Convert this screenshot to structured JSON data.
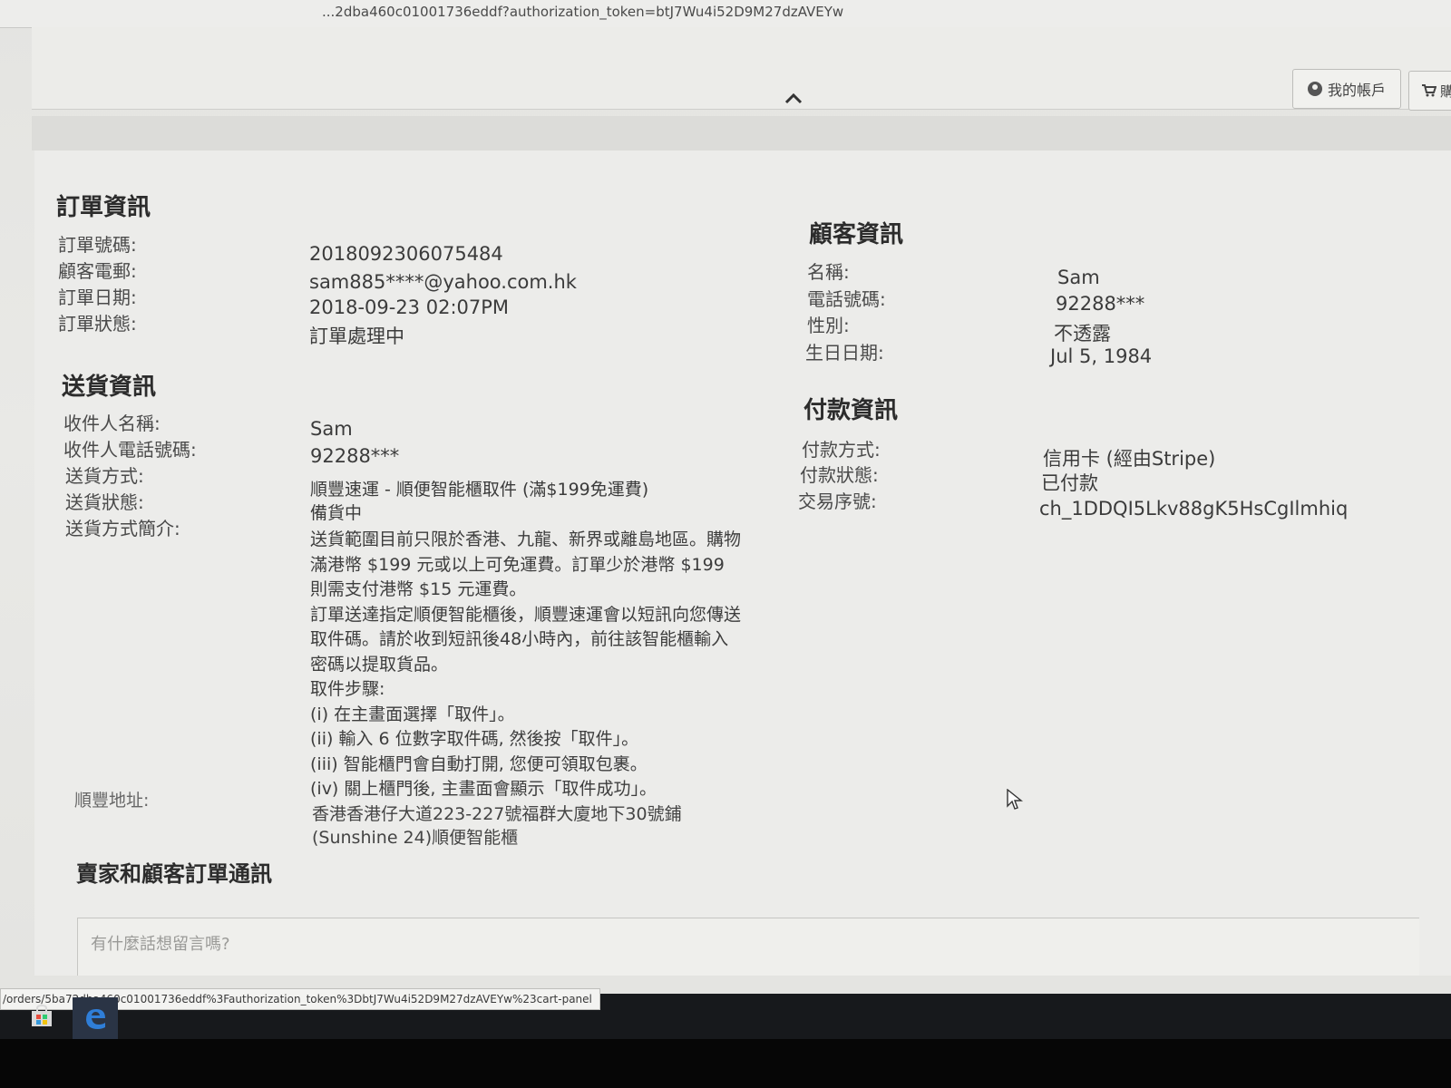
{
  "browser": {
    "address": "...2dba460c01001736eddf?authorization_token=btJ7Wu4i52D9M27dzAVEYw",
    "status_url": "/orders/5ba72dba460c01001736eddf%3Fauthorization_token%3DbtJ7Wu4i52D9M27dzAVEYw%23cart-panel"
  },
  "header": {
    "collapse_icon": "chevron-up-icon",
    "account_label": "我的帳戶",
    "account_icon": "user-circle-icon",
    "cart_label": "購",
    "cart_icon": "cart-icon"
  },
  "order": {
    "heading": "訂單資訊",
    "number_label": "訂單號碼:",
    "number": "2018092306075484",
    "email_label": "顧客電郵:",
    "email": "sam885****@yahoo.com.hk",
    "date_label": "訂單日期:",
    "date": "2018-09-23 02:07PM",
    "status_label": "訂單狀態:",
    "status": "訂單處理中"
  },
  "delivery": {
    "heading": "送貨資訊",
    "recipient_label": "收件人名稱:",
    "recipient": "Sam",
    "phone_label": "收件人電話號碼:",
    "phone": "92288***",
    "method_label": "送貨方式:",
    "method": "順豐速運 - 順便智能櫃取件 (滿$199免運費)",
    "status_label": "送貨狀態:",
    "status": "備貨中",
    "intro_label": "送貨方式簡介:",
    "intro": [
      "送貨範圍目前只限於香港、九龍、新界或離島地區。購物滿港幣 $199 元或以上可免運費。訂單少於港幣 $199 則需支付港幣 $15 元運費。",
      "訂單送達指定順便智能櫃後，順豐速運會以短訊向您傳送取件碼。請於收到短訊後48小時內，前往該智能櫃輸入密碼以提取貨品。",
      "取件步驟:",
      "(i) 在主畫面選擇「取件」。",
      "(ii) 輸入 6 位數字取件碼, 然後按「取件」。",
      "(iii) 智能櫃門會自動打開, 您便可領取包裹。",
      "(iv) 關上櫃門後, 主畫面會顯示「取件成功」。"
    ],
    "address_label": "順豐地址:",
    "address": "香港香港仔大道223-227號福群大廈地下30號鋪(Sunshine 24)順便智能櫃"
  },
  "customer": {
    "heading": "顧客資訊",
    "name_label": "名稱:",
    "name": "Sam",
    "phone_label": "電話號碼:",
    "phone": "92288***",
    "gender_label": "性別:",
    "gender": "不透露",
    "birthday_label": "生日日期:",
    "birthday": "Jul 5, 1984"
  },
  "payment": {
    "heading": "付款資訊",
    "method_label": "付款方式:",
    "method": "信用卡 (經由Stripe)",
    "status_label": "付款狀態:",
    "status": "已付款",
    "txn_label": "交易序號:",
    "txn": "ch_1DDQI5Lkv88gK5HsCgIlmhiq"
  },
  "messages": {
    "heading": "賣家和顧客訂單通訊",
    "placeholder": "有什麼話想留言嗎?"
  },
  "taskbar": {
    "store_icon": "store-icon",
    "edge_icon": "edge-browser-icon"
  },
  "colors": {
    "page_bg": "#ececea",
    "taskbar": "#17191c"
  }
}
